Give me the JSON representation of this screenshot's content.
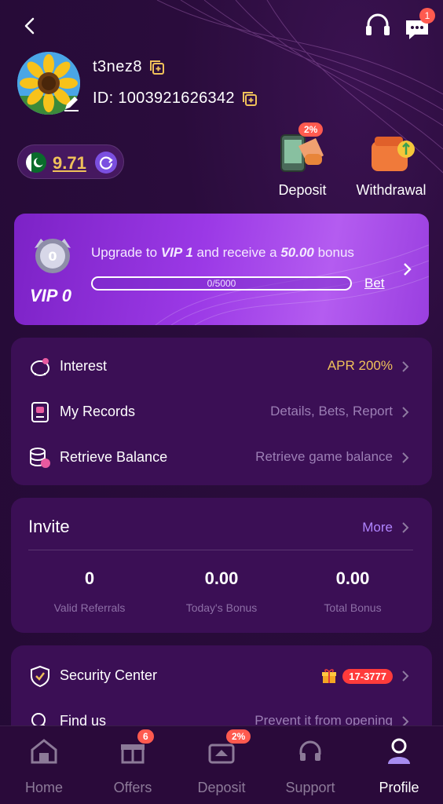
{
  "header": {
    "back_icon": "chevron-left-icon",
    "support_icon": "headset-icon",
    "chat_icon": "chat-icon",
    "chat_badge": "1"
  },
  "profile": {
    "username": "t3nez8",
    "id_text": "ID: 1003921626342"
  },
  "balance": {
    "value": "9.71",
    "flag": "pakistan-flag"
  },
  "actions": [
    {
      "label": "Deposit",
      "badge": "2%"
    },
    {
      "label": "Withdrawal"
    }
  ],
  "vip": {
    "level": "VIP 0",
    "medal_text": "0",
    "text_prefix": "Upgrade to ",
    "target": "VIP 1",
    "text_middle": " and receive a ",
    "bonus": "50.00",
    "text_suffix": " bonus",
    "progress_text": "0/5000",
    "progress_fraction": 0,
    "bet_label": "Bet"
  },
  "menu": [
    {
      "label": "Interest",
      "value": "APR 200%"
    },
    {
      "label": "My Records",
      "value": "Details, Bets, Report"
    },
    {
      "label": "Retrieve Balance",
      "value": "Retrieve game balance"
    }
  ],
  "invite": {
    "title": "Invite",
    "more": "More",
    "stats": [
      {
        "value": "0",
        "caption": "Valid Referrals"
      },
      {
        "value": "0.00",
        "caption": "Today's Bonus"
      },
      {
        "value": "0.00",
        "caption": "Total Bonus"
      }
    ]
  },
  "security": [
    {
      "label": "Security Center",
      "badge": "17-3777"
    },
    {
      "label": "Find us",
      "value": "Prevent it from opening"
    }
  ],
  "nav": [
    {
      "label": "Home"
    },
    {
      "label": "Offers",
      "badge": "6"
    },
    {
      "label": "Deposit",
      "badge": "2%"
    },
    {
      "label": "Support"
    },
    {
      "label": "Profile"
    }
  ],
  "colors": {
    "accent_gold": "#f0c15a",
    "badge_red": "#ff5a4f",
    "vip_purple": "#9b39e6",
    "muted": "#9c7fb5"
  }
}
